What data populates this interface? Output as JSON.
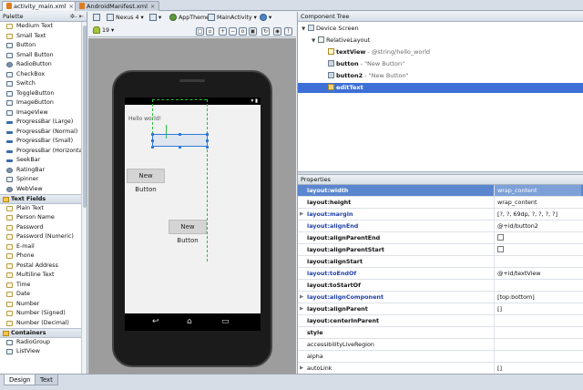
{
  "tabs": [
    {
      "label": "activity_main.xml",
      "active": true
    },
    {
      "label": "AndroidManifest.xml",
      "active": false
    }
  ],
  "palette": {
    "title": "Palette",
    "tools": "✲- ⇤",
    "items": [
      {
        "label": "Medium Text",
        "kind": "text"
      },
      {
        "label": "Small Text",
        "kind": "text"
      },
      {
        "label": "Button",
        "kind": "box"
      },
      {
        "label": "Small Button",
        "kind": "box"
      },
      {
        "label": "RadioButton",
        "kind": "dot"
      },
      {
        "label": "CheckBox",
        "kind": "box"
      },
      {
        "label": "Switch",
        "kind": "box"
      },
      {
        "label": "ToggleButton",
        "kind": "box"
      },
      {
        "label": "ImageButton",
        "kind": "box"
      },
      {
        "label": "ImageView",
        "kind": "box"
      },
      {
        "label": "ProgressBar (Large)",
        "kind": "bar"
      },
      {
        "label": "ProgressBar (Normal)",
        "kind": "bar"
      },
      {
        "label": "ProgressBar (Small)",
        "kind": "bar"
      },
      {
        "label": "ProgressBar (Horizontal)",
        "kind": "bar"
      },
      {
        "label": "SeekBar",
        "kind": "bar"
      },
      {
        "label": "RatingBar",
        "kind": "dot"
      },
      {
        "label": "Spinner",
        "kind": "box"
      },
      {
        "label": "WebView",
        "kind": "dot"
      },
      {
        "label": "Text Fields",
        "kind": "cat"
      },
      {
        "label": "Plain Text",
        "kind": "text"
      },
      {
        "label": "Person Name",
        "kind": "text"
      },
      {
        "label": "Password",
        "kind": "text"
      },
      {
        "label": "Password (Numeric)",
        "kind": "text"
      },
      {
        "label": "E-mail",
        "kind": "text"
      },
      {
        "label": "Phone",
        "kind": "text"
      },
      {
        "label": "Postal Address",
        "kind": "text"
      },
      {
        "label": "Multiline Text",
        "kind": "text"
      },
      {
        "label": "Time",
        "kind": "text"
      },
      {
        "label": "Date",
        "kind": "text"
      },
      {
        "label": "Number",
        "kind": "text"
      },
      {
        "label": "Number (Signed)",
        "kind": "text"
      },
      {
        "label": "Number (Decimal)",
        "kind": "text"
      },
      {
        "label": "Containers",
        "kind": "cat"
      },
      {
        "label": "RadioGroup",
        "kind": "box"
      },
      {
        "label": "ListView",
        "kind": "box"
      }
    ]
  },
  "toolbar": {
    "device": "Nexus 4 ▾",
    "theme": "AppTheme",
    "activity": "MainActivity ▾",
    "api": "19 ▾"
  },
  "canvas": {
    "hello_text": "Hello world!",
    "button1_label": "New Button",
    "button2_label": "New Button"
  },
  "component_tree": {
    "title": "Component Tree",
    "rows": [
      {
        "name": "Device Screen",
        "detail": "",
        "depth": 0,
        "icon": "device",
        "selected": false,
        "bold": false
      },
      {
        "name": "RelativeLayout",
        "detail": "",
        "depth": 1,
        "icon": "layout",
        "selected": false,
        "bold": false
      },
      {
        "name": "textView",
        "detail": " - @string/hello_world",
        "depth": 2,
        "icon": "tv",
        "selected": false,
        "bold": true
      },
      {
        "name": "button",
        "detail": " - \"New Button\"",
        "depth": 2,
        "icon": "btnic",
        "selected": false,
        "bold": true
      },
      {
        "name": "button2",
        "detail": " - \"New Button\"",
        "depth": 2,
        "icon": "btnic",
        "selected": false,
        "bold": true
      },
      {
        "name": "editText",
        "detail": "",
        "depth": 2,
        "icon": "et",
        "selected": true,
        "bold": true
      }
    ]
  },
  "properties": {
    "title": "Properties",
    "rows": [
      {
        "key": "layout:width",
        "value": "wrap_content",
        "style": "blue",
        "expand": false,
        "check": false,
        "highlight": true
      },
      {
        "key": "layout:height",
        "value": "wrap_content",
        "style": "bold",
        "expand": false,
        "check": false,
        "highlight": false
      },
      {
        "key": "layout:margin",
        "value": "[?, ?, 69dp, ?, ?, ?, ?]",
        "style": "blue",
        "expand": true,
        "check": false,
        "highlight": false
      },
      {
        "key": "layout:alignEnd",
        "value": "@+id/button2",
        "style": "blue",
        "expand": false,
        "check": false,
        "highlight": false
      },
      {
        "key": "layout:alignParentEnd",
        "value": "",
        "style": "bold",
        "expand": false,
        "check": true,
        "highlight": false
      },
      {
        "key": "layout:alignParentStart",
        "value": "",
        "style": "bold",
        "expand": false,
        "check": true,
        "highlight": false
      },
      {
        "key": "layout:alignStart",
        "value": "",
        "style": "bold",
        "expand": false,
        "check": false,
        "highlight": false
      },
      {
        "key": "layout:toEndOf",
        "value": "@+id/textView",
        "style": "blue",
        "expand": false,
        "check": false,
        "highlight": false
      },
      {
        "key": "layout:toStartOf",
        "value": "",
        "style": "bold",
        "expand": false,
        "check": false,
        "highlight": false
      },
      {
        "key": "layout:alignComponent",
        "value": "[top:bottom]",
        "style": "blue",
        "expand": true,
        "check": false,
        "highlight": false
      },
      {
        "key": "layout:alignParent",
        "value": "[]",
        "style": "bold",
        "expand": true,
        "check": false,
        "highlight": false
      },
      {
        "key": "layout:centerInParent",
        "value": "",
        "style": "bold",
        "expand": false,
        "check": false,
        "highlight": false
      },
      {
        "key": "style",
        "value": "",
        "style": "bold",
        "expand": false,
        "check": false,
        "highlight": false
      },
      {
        "key": "accessibilityLiveRegion",
        "value": "",
        "style": "",
        "expand": false,
        "check": false,
        "highlight": false
      },
      {
        "key": "alpha",
        "value": "",
        "style": "",
        "expand": false,
        "check": false,
        "highlight": false
      },
      {
        "key": "autoLink",
        "value": "[]",
        "style": "",
        "expand": true,
        "check": false,
        "highlight": false
      }
    ]
  },
  "bottom_tabs": [
    {
      "label": "Design",
      "active": true
    },
    {
      "label": "Text",
      "active": false
    }
  ]
}
